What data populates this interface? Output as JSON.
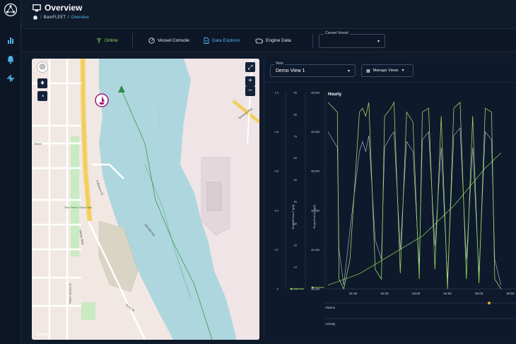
{
  "header": {
    "title": "Overview",
    "breadcrumb": [
      "BareFLEET",
      "/",
      "Overview"
    ]
  },
  "toolbar": {
    "status": "Online",
    "items": [
      "Vessel Console",
      "Data Explorer",
      "Engine Data"
    ],
    "current_vessel_label": "Current Vessel",
    "current_vessel_value": ""
  },
  "icons": {
    "logo": "network-logo-icon",
    "home": "home-icon",
    "nav": [
      "chart-icon",
      "bell-icon",
      "fleet-icon"
    ],
    "status": "signal-icon",
    "vessel_console": "gauge-icon",
    "data_explorer": "document-icon",
    "engine_data": "engine-icon",
    "map_controls": [
      "fullscreen-icon",
      "zoom-in-icon",
      "zoom-out-icon",
      "layers-icon",
      "alert-icon",
      "speed-icon"
    ]
  },
  "colors": {
    "accent": "#4fb3e8",
    "online": "#8bd94e",
    "series_green": "#9bd660",
    "series_light": "#d8e7f5",
    "water": "#aed6df",
    "land": "#f1e8e3"
  },
  "map": {
    "labels": [
      "Street",
      "San Pedro Plaza Park",
      "Terminal Way",
      "Harbor Blvd",
      "S Beacon St",
      "Ferry St",
      "Seaside Ave",
      "Palos Verdes St"
    ],
    "attribution": "mapbox"
  },
  "chart_panel": {
    "view_label": "View",
    "view_value": "Demo View 1",
    "manage_label": "Manage Views",
    "chart_title": "Hourly",
    "lanes": [
      "Alarms",
      "Activity"
    ]
  },
  "chart_data": {
    "type": "line",
    "title": "Hourly",
    "x_ticks": [
      "01:00",
      "02:00",
      "03:00",
      "04:00",
      "05:00",
      "06:00"
    ],
    "y_axes": [
      {
        "ticks": [
          "0",
          "0.2",
          "0.4",
          "0.6",
          "0.8",
          "1.0"
        ],
        "label": ""
      },
      {
        "ticks": [
          "0",
          "10",
          "20",
          "30",
          "40",
          "50",
          "60",
          "70",
          "80",
          "90"
        ],
        "label": "EngOilPress P [psi]"
      },
      {
        "ticks": [
          "48,340",
          "48,400",
          "48,450",
          "48,500",
          "48,550",
          "48,600"
        ],
        "label": "EngLoFuel (t) [gal]"
      }
    ],
    "series": [
      {
        "x": [
          0,
          0.3,
          0.35,
          0.5,
          0.7,
          1.0,
          1.1,
          1.2,
          1.3,
          1.5,
          1.7,
          1.8,
          2.0,
          2.1,
          2.3,
          2.5,
          2.7,
          2.9,
          3.0,
          3.2,
          3.4,
          3.6,
          3.8,
          4.0,
          4.2,
          4.4,
          4.6,
          4.8,
          5.0,
          5.2,
          5.3,
          5.5
        ],
        "values": [
          95,
          90,
          5,
          0,
          15,
          90,
          92,
          88,
          95,
          10,
          5,
          88,
          92,
          95,
          8,
          90,
          85,
          5,
          90,
          92,
          10,
          88,
          0,
          92,
          95,
          5,
          88,
          3,
          92,
          90,
          5,
          0
        ]
      },
      {
        "x": [
          0,
          0.3,
          0.35,
          0.5,
          0.7,
          1.0,
          1.1,
          1.2,
          1.3,
          1.5,
          1.7,
          1.8,
          2.0,
          2.1,
          2.3,
          2.5,
          2.7,
          2.9,
          3.0,
          3.2,
          3.4,
          3.6,
          3.8,
          4.0,
          4.2,
          4.4,
          4.6,
          4.8,
          5.0,
          5.2,
          5.3,
          5.5
        ],
        "values": [
          80,
          72,
          20,
          2,
          30,
          70,
          75,
          70,
          78,
          25,
          15,
          72,
          78,
          80,
          20,
          75,
          70,
          12,
          76,
          80,
          22,
          72,
          5,
          78,
          82,
          15,
          72,
          8,
          80,
          76,
          15,
          2
        ]
      },
      {
        "x": [
          0,
          1.0,
          2.0,
          3.0,
          4.0,
          5.0,
          5.5
        ],
        "values": [
          48345,
          48360,
          48385,
          48410,
          48450,
          48500,
          48520
        ]
      }
    ]
  }
}
